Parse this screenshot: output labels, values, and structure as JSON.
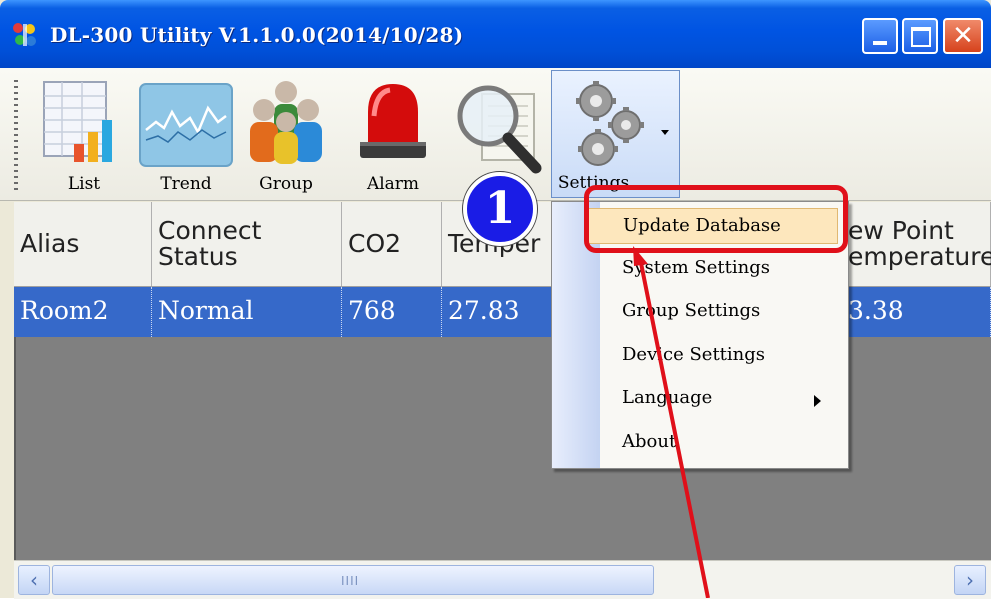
{
  "window": {
    "title": "DL-300 Utility V.1.1.0.0(2014/10/28)",
    "close_glyph": "✕"
  },
  "toolbar": {
    "items": [
      {
        "label": "List",
        "icon": "list-icon"
      },
      {
        "label": "Trend",
        "icon": "trend-chart-icon"
      },
      {
        "label": "Group",
        "icon": "group-people-icon"
      },
      {
        "label": "Alarm",
        "icon": "alarm-siren-icon"
      },
      {
        "label": "",
        "icon": "magnifier-search-icon"
      },
      {
        "label": "Settings",
        "icon": "gears-settings-icon"
      }
    ]
  },
  "grid": {
    "columns": [
      "Alias",
      "Connect Status",
      "CO2",
      "Temper",
      "ew Point emperature"
    ],
    "rows": [
      [
        "Room2",
        "Normal",
        "768",
        "27.83",
        "3.38"
      ]
    ]
  },
  "menu": {
    "items": [
      {
        "label": "Update Database",
        "highlighted": true
      },
      {
        "label": "System Settings"
      },
      {
        "label": "Group Settings"
      },
      {
        "label": "Device Settings"
      },
      {
        "label": "Language",
        "has_submenu": true
      },
      {
        "label": "About"
      }
    ]
  },
  "annotation": {
    "step_number": "1",
    "callout_color": "#e0101a",
    "badge_color": "#1a1ce6"
  },
  "scrollbar": {
    "thumb_grip": "IIII",
    "left_arrow": "‹",
    "right_arrow": "›"
  }
}
